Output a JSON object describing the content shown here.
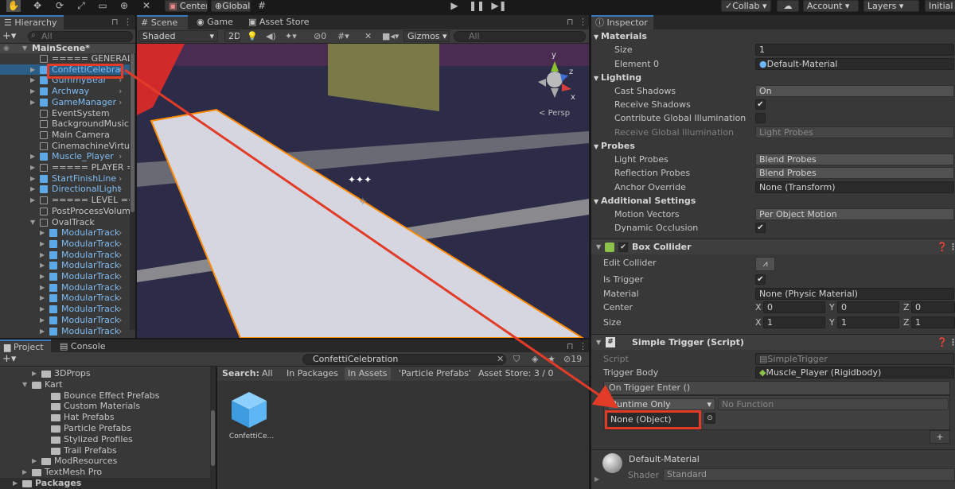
{
  "toolbar": {
    "pivot": "Center",
    "space": "Global",
    "collab": "Collab",
    "account": "Account",
    "layers": "Layers",
    "layout": "Initial"
  },
  "hierarchy": {
    "tab": "Hierarchy",
    "search_placeholder": "All",
    "scene": "MainScene*",
    "items": [
      {
        "label": "===== GENERAL =",
        "prefab": false
      },
      {
        "label": "ConfettiCelebrat",
        "prefab": true
      },
      {
        "label": "GummyBear",
        "prefab": true
      },
      {
        "label": "Archway",
        "prefab": true
      },
      {
        "label": "GameManager",
        "prefab": true
      },
      {
        "label": "EventSystem",
        "prefab": false
      },
      {
        "label": "BackgroundMusic",
        "prefab": false
      },
      {
        "label": "Main Camera",
        "prefab": false
      },
      {
        "label": "CinemachineVirtua",
        "prefab": false
      },
      {
        "label": "Muscle_Player",
        "prefab": true
      },
      {
        "label": "===== PLAYER ==",
        "prefab": false
      },
      {
        "label": "StartFinishLine",
        "prefab": true
      },
      {
        "label": "DirectionalLight",
        "prefab": true
      },
      {
        "label": "===== LEVEL ==",
        "prefab": false
      },
      {
        "label": "PostProcessVolum",
        "prefab": false
      },
      {
        "label": "OvalTrack",
        "prefab": false
      },
      {
        "label": "ModularTrack",
        "prefab": true
      },
      {
        "label": "ModularTrack",
        "prefab": true
      },
      {
        "label": "ModularTrack",
        "prefab": true
      },
      {
        "label": "ModularTrack",
        "prefab": true
      },
      {
        "label": "ModularTrack",
        "prefab": true
      },
      {
        "label": "ModularTrack",
        "prefab": true
      },
      {
        "label": "ModularTrack",
        "prefab": true
      },
      {
        "label": "ModularTrack",
        "prefab": true
      },
      {
        "label": "ModularTrack",
        "prefab": true
      },
      {
        "label": "ModularTrack",
        "prefab": true
      }
    ]
  },
  "scene": {
    "tabs": [
      "Scene",
      "Game",
      "Asset Store"
    ],
    "shading": "Shaded",
    "mode_2d": "2D",
    "hidden_count": "0",
    "gizmos": "Gizmos",
    "search_placeholder": "All",
    "persp": "Persp",
    "axis_y": "y",
    "axis_z": "z",
    "axis_x": "x"
  },
  "project": {
    "tabs": [
      "Project",
      "Console"
    ],
    "search_value": "ConfettiCelebration",
    "search_label": "Search:",
    "filters": [
      "All",
      "In Packages",
      "In Assets",
      "'Particle Prefabs'"
    ],
    "asset_store": "Asset Store: 3 / 0",
    "count": "19",
    "tree": [
      {
        "label": "3DProps",
        "level": 2
      },
      {
        "label": "Kart",
        "level": 1
      },
      {
        "label": "Bounce Effect Prefabs",
        "level": 3
      },
      {
        "label": "Custom Materials",
        "level": 3
      },
      {
        "label": "Hat Prefabs",
        "level": 3
      },
      {
        "label": "Particle Prefabs",
        "level": 3
      },
      {
        "label": "Stylized Profiles",
        "level": 3
      },
      {
        "label": "Trail Prefabs",
        "level": 3
      },
      {
        "label": "ModResources",
        "level": 2
      },
      {
        "label": "TextMesh Pro",
        "level": 1
      },
      {
        "label": "Packages",
        "level": 0
      }
    ],
    "asset_label": "ConfettiCe..."
  },
  "inspector": {
    "tab": "Inspector",
    "materials": {
      "header": "Materials",
      "size_label": "Size",
      "size": "1",
      "element_label": "Element 0",
      "element": "Default-Material"
    },
    "lighting": {
      "header": "Lighting",
      "cast_shadows_label": "Cast Shadows",
      "cast_shadows": "On",
      "receive_shadows_label": "Receive Shadows",
      "contribute_gi_label": "Contribute Global Illumination",
      "receive_gi_label": "Receive Global Illumination",
      "receive_gi": "Light Probes"
    },
    "probes": {
      "header": "Probes",
      "light_probes_label": "Light Probes",
      "light_probes": "Blend Probes",
      "reflection_label": "Reflection Probes",
      "reflection": "Blend Probes",
      "anchor_label": "Anchor Override",
      "anchor": "None (Transform)"
    },
    "additional": {
      "header": "Additional Settings",
      "motion_label": "Motion Vectors",
      "motion": "Per Object Motion",
      "dynamic_label": "Dynamic Occlusion"
    },
    "box_collider": {
      "title": "Box Collider",
      "edit_label": "Edit Collider",
      "trigger_label": "Is Trigger",
      "material_label": "Material",
      "material": "None (Physic Material)",
      "center_label": "Center",
      "center": [
        "0",
        "0",
        "0"
      ],
      "size_label": "Size",
      "size": [
        "1",
        "1",
        "1"
      ],
      "axes": [
        "X",
        "Y",
        "Z"
      ]
    },
    "simple_trigger": {
      "title": "Simple Trigger (Script)",
      "script_label": "Script",
      "script": "SimpleTrigger",
      "body_label": "Trigger Body",
      "body": "Muscle_Player (Rigidbody)",
      "event": "On Trigger Enter ()",
      "runtime": "Runtime Only",
      "function": "No Function",
      "object": "None (Object)"
    },
    "material_footer": {
      "name": "Default-Material",
      "shader_label": "Shader",
      "shader": "Standard"
    }
  },
  "colors": {
    "accent": "#3a79bb",
    "highlight": "#e23c28",
    "prefab": "#5da9e8"
  }
}
